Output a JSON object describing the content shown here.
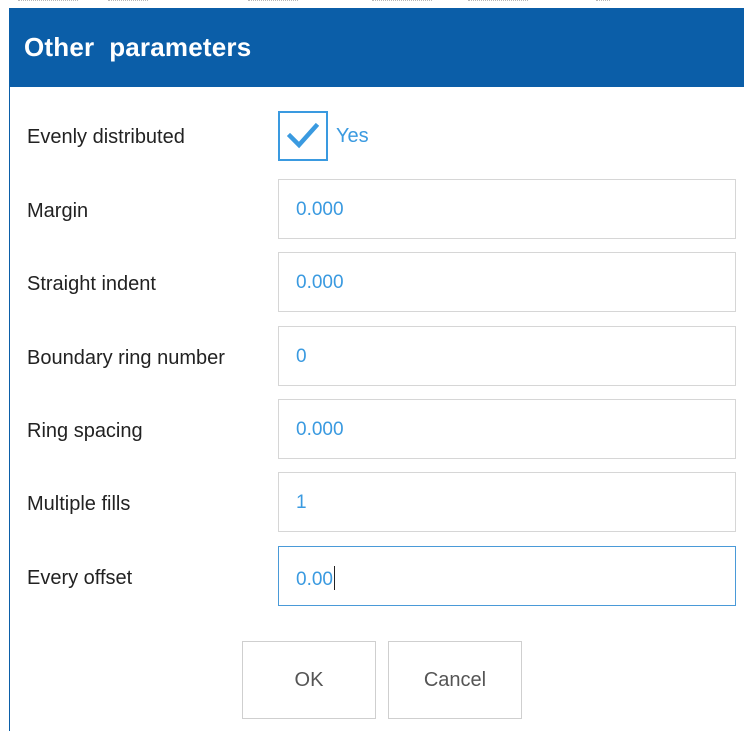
{
  "dialog": {
    "title": "Other  parameters"
  },
  "evenly_distributed": {
    "label": "Evenly distributed",
    "checked": true,
    "check_text": "Yes",
    "check_icon": "checkmark-icon"
  },
  "fields": [
    {
      "label": "Margin",
      "value": "0.000"
    },
    {
      "label": "Straight indent",
      "value": "0.000"
    },
    {
      "label": "Boundary ring number",
      "value": "0"
    },
    {
      "label": "Ring spacing",
      "value": "0.000"
    },
    {
      "label": "Multiple fills",
      "value": "1"
    },
    {
      "label": "Every offset",
      "value": "0.00",
      "focused": true
    }
  ],
  "buttons": {
    "ok_label": "OK",
    "cancel_label": "Cancel"
  },
  "colors": {
    "titlebar": "#0b5ea8",
    "accent": "#3a9ae0",
    "text": "#222222"
  }
}
